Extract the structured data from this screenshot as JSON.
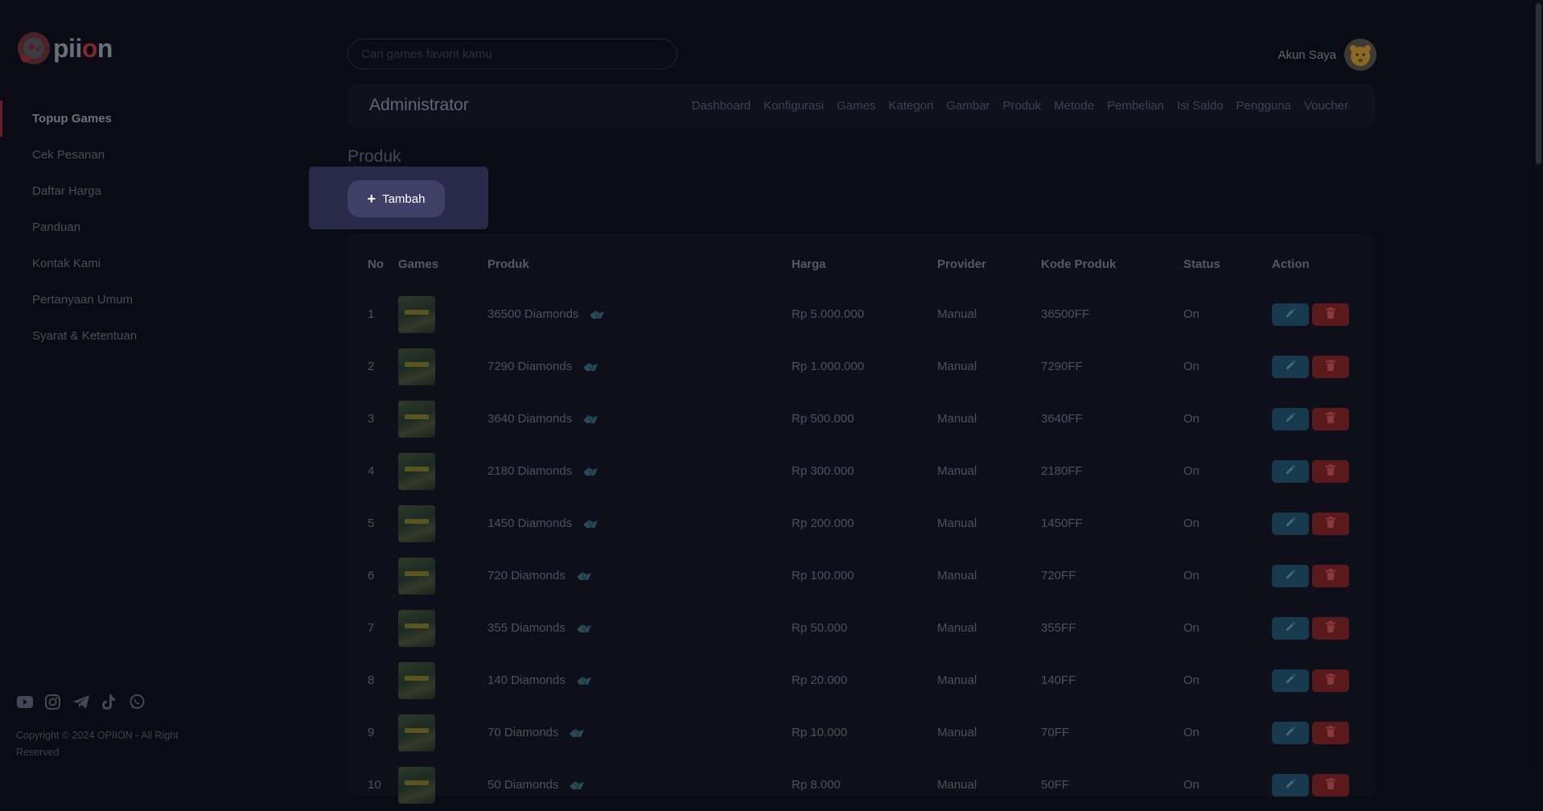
{
  "brand": {
    "logo_text_a": "pii",
    "logo_text_b": "o",
    "logo_text_c": "n"
  },
  "sidebar": {
    "items": [
      {
        "label": "Topup Games",
        "active": true
      },
      {
        "label": "Cek Pesanan"
      },
      {
        "label": "Daftar Harga"
      },
      {
        "label": "Panduan"
      },
      {
        "label": "Kontak Kami"
      },
      {
        "label": "Pertanyaan Umum"
      },
      {
        "label": "Syarat & Ketentuan"
      }
    ],
    "socials": [
      "youtube-icon",
      "instagram-icon",
      "telegram-icon",
      "tiktok-icon",
      "whatsapp-icon"
    ],
    "copyright": "Copyright © 2024 OPIION - All Right Reserved"
  },
  "search": {
    "placeholder": "Cari games favorit kamu"
  },
  "account": {
    "label": "Akun Saya"
  },
  "admin": {
    "title": "Administrator",
    "nav": [
      "Dashboard",
      "Konfigurasi",
      "Games",
      "Kategori",
      "Gambar",
      "Produk",
      "Metode",
      "Pembelian",
      "Isi Saldo",
      "Pengguna",
      "Voucher"
    ]
  },
  "page": {
    "title": "Produk",
    "add_button": "Tambah"
  },
  "table": {
    "headers": [
      "No",
      "Games",
      "Produk",
      "Harga",
      "Provider",
      "Kode Produk",
      "Status",
      "Action"
    ],
    "rows": [
      {
        "no": "1",
        "produk": "36500 Diamonds",
        "harga": "Rp 5.000.000",
        "provider": "Manual",
        "kode": "36500FF",
        "status": "On"
      },
      {
        "no": "2",
        "produk": "7290 Diamonds",
        "harga": "Rp 1.000.000",
        "provider": "Manual",
        "kode": "7290FF",
        "status": "On"
      },
      {
        "no": "3",
        "produk": "3640 Diamonds",
        "harga": "Rp 500.000",
        "provider": "Manual",
        "kode": "3640FF",
        "status": "On"
      },
      {
        "no": "4",
        "produk": "2180 Diamonds",
        "harga": "Rp 300.000",
        "provider": "Manual",
        "kode": "2180FF",
        "status": "On"
      },
      {
        "no": "5",
        "produk": "1450 Diamonds",
        "harga": "Rp 200.000",
        "provider": "Manual",
        "kode": "1450FF",
        "status": "On"
      },
      {
        "no": "6",
        "produk": "720 Diamonds",
        "harga": "Rp 100.000",
        "provider": "Manual",
        "kode": "720FF",
        "status": "On"
      },
      {
        "no": "7",
        "produk": "355 Diamonds",
        "harga": "Rp 50.000",
        "provider": "Manual",
        "kode": "355FF",
        "status": "On"
      },
      {
        "no": "8",
        "produk": "140 Diamonds",
        "harga": "Rp 20.000",
        "provider": "Manual",
        "kode": "140FF",
        "status": "On"
      },
      {
        "no": "9",
        "produk": "70 Diamonds",
        "harga": "Rp 10.000",
        "provider": "Manual",
        "kode": "70FF",
        "status": "On"
      },
      {
        "no": "10",
        "produk": "50 Diamonds",
        "harga": "Rp 8.000",
        "provider": "Manual",
        "kode": "50FF",
        "status": "On"
      }
    ]
  },
  "colors": {
    "background": "#0b0b15",
    "accent_red": "#6a1d22",
    "edit": "#173a4e",
    "delete": "#5a1a1c",
    "highlight": "#282a4a"
  }
}
